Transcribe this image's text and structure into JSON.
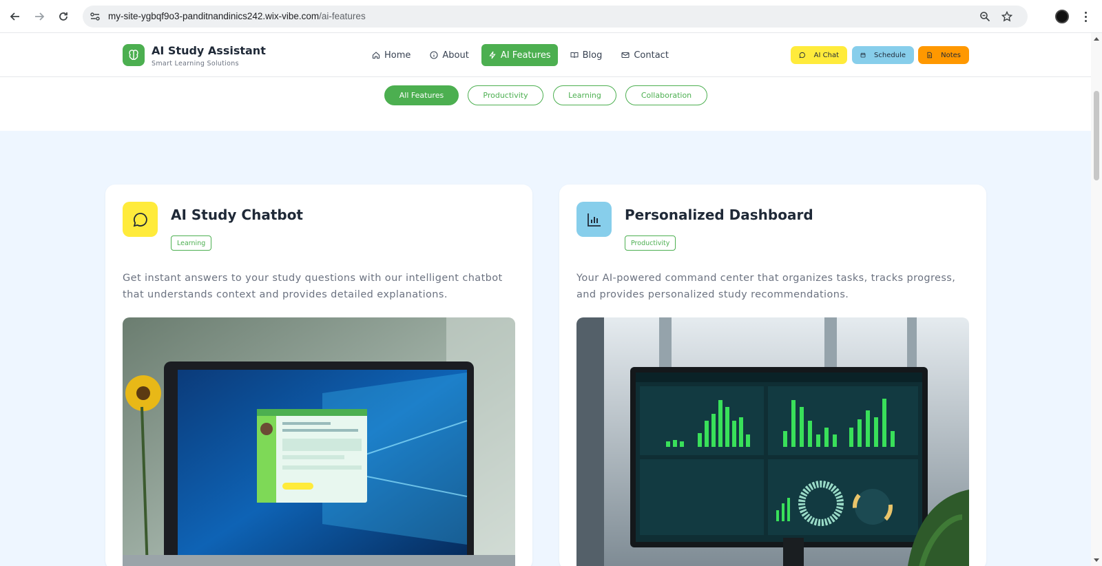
{
  "browser": {
    "url_host": "my-site-ygbqf9o3-panditnandinics242.wix-vibe.com",
    "url_path": "/ai-features",
    "icons": [
      "back-icon",
      "forward-icon",
      "reload-icon",
      "site-info-icon",
      "zoom-icon",
      "bookmark-star-icon",
      "profile-avatar",
      "more-menu-icon"
    ]
  },
  "header": {
    "brand_title": "AI Study Assistant",
    "brand_subtitle": "Smart Learning Solutions",
    "brand_color": "#4caf50",
    "nav": [
      {
        "label": "Home",
        "icon": "home-icon"
      },
      {
        "label": "About",
        "icon": "info-icon"
      },
      {
        "label": "AI Features",
        "icon": "lightning-icon",
        "active": true
      },
      {
        "label": "Blog",
        "icon": "book-icon"
      },
      {
        "label": "Contact",
        "icon": "mail-icon"
      }
    ],
    "quick_actions": [
      {
        "label": "AI Chat",
        "icon": "chat-icon",
        "color": "#ffeb3b"
      },
      {
        "label": "Schedule",
        "icon": "calendar-icon",
        "color": "#87ceeb"
      },
      {
        "label": "Notes",
        "icon": "document-icon",
        "color": "#ff9800"
      }
    ]
  },
  "filters": {
    "items": [
      "All Features",
      "Productivity",
      "Learning",
      "Collaboration"
    ],
    "active": "All Features"
  },
  "cards": [
    {
      "title": "AI Study Chatbot",
      "tag": "Learning",
      "icon": "chat-bubble-icon",
      "icon_bg": "#ffeb3b",
      "description": "Get instant answers to your study questions with our intelligent chatbot that understands context and provides detailed explanations.",
      "image": "laptop-chatbot-image"
    },
    {
      "title": "Personalized Dashboard",
      "tag": "Productivity",
      "icon": "bar-chart-icon",
      "icon_bg": "#87ceeb",
      "description": "Your AI-powered command center that organizes tasks, tracks progress, and provides personalized study recommendations.",
      "image": "monitor-dashboard-image"
    }
  ]
}
